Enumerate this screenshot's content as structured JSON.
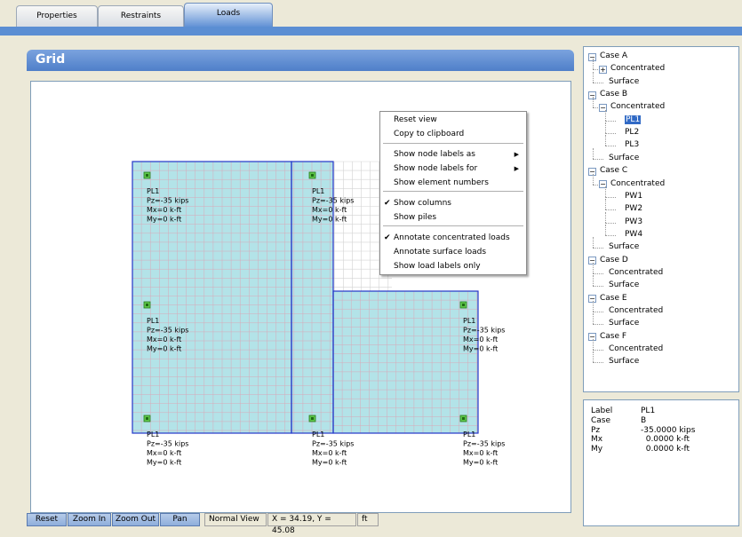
{
  "tabs": [
    {
      "label": "Properties",
      "active": false
    },
    {
      "label": "Restraints",
      "active": false
    },
    {
      "label": "Loads",
      "active": true
    }
  ],
  "panel": {
    "title": "Grid"
  },
  "status_bar": {
    "buttons": [
      "Reset",
      "Zoom In",
      "Zoom Out",
      "Pan"
    ],
    "view_mode": "Normal View",
    "coords": "X = 34.19, Y = 45.08",
    "units": "ft"
  },
  "context_menu": {
    "items": [
      {
        "label": "Reset view",
        "checked": false,
        "submenu": false
      },
      {
        "label": "Copy to clipboard",
        "checked": false,
        "submenu": false
      },
      {
        "label": "Show node labels as",
        "checked": false,
        "submenu": true
      },
      {
        "label": "Show node labels for",
        "checked": false,
        "submenu": true
      },
      {
        "label": "Show element numbers",
        "checked": false,
        "submenu": false
      },
      {
        "label": "Show columns",
        "checked": true,
        "submenu": false
      },
      {
        "label": "Show piles",
        "checked": false,
        "submenu": false
      },
      {
        "label": "Annotate concentrated loads",
        "checked": true,
        "submenu": false
      },
      {
        "label": "Annotate surface loads",
        "checked": false,
        "submenu": false
      },
      {
        "label": "Show load labels only",
        "checked": false,
        "submenu": false
      }
    ]
  },
  "tree": [
    {
      "label": "Case A",
      "depth": 0,
      "expander": "-"
    },
    {
      "label": "Concentrated",
      "depth": 1,
      "expander": "+"
    },
    {
      "label": "Surface",
      "depth": 1,
      "expander": ""
    },
    {
      "label": "Case B",
      "depth": 0,
      "expander": "-"
    },
    {
      "label": "Concentrated",
      "depth": 1,
      "expander": "-"
    },
    {
      "label": "PL1",
      "depth": 2,
      "expander": "",
      "selected": true
    },
    {
      "label": "PL2",
      "depth": 2,
      "expander": ""
    },
    {
      "label": "PL3",
      "depth": 2,
      "expander": ""
    },
    {
      "label": "Surface",
      "depth": 1,
      "expander": ""
    },
    {
      "label": "Case C",
      "depth": 0,
      "expander": "-"
    },
    {
      "label": "Concentrated",
      "depth": 1,
      "expander": "-"
    },
    {
      "label": "PW1",
      "depth": 2,
      "expander": ""
    },
    {
      "label": "PW2",
      "depth": 2,
      "expander": ""
    },
    {
      "label": "PW3",
      "depth": 2,
      "expander": ""
    },
    {
      "label": "PW4",
      "depth": 2,
      "expander": ""
    },
    {
      "label": "Surface",
      "depth": 1,
      "expander": ""
    },
    {
      "label": "Case D",
      "depth": 0,
      "expander": "-"
    },
    {
      "label": "Concentrated",
      "depth": 1,
      "expander": ""
    },
    {
      "label": "Surface",
      "depth": 1,
      "expander": ""
    },
    {
      "label": "Case E",
      "depth": 0,
      "expander": "-"
    },
    {
      "label": "Concentrated",
      "depth": 1,
      "expander": ""
    },
    {
      "label": "Surface",
      "depth": 1,
      "expander": ""
    },
    {
      "label": "Case F",
      "depth": 0,
      "expander": "-"
    },
    {
      "label": "Concentrated",
      "depth": 1,
      "expander": ""
    },
    {
      "label": "Surface",
      "depth": 1,
      "expander": ""
    }
  ],
  "properties": [
    {
      "key": "Label",
      "value": "PL1"
    },
    {
      "key": "Case",
      "value": "B"
    },
    {
      "key": "Pz",
      "value": "-35.0000 kips"
    },
    {
      "key": "Mx",
      "value": "  0.0000 k-ft"
    },
    {
      "key": "My",
      "value": "  0.0000 k-ft"
    }
  ],
  "grid": {
    "node_labels": [
      [
        "PL1",
        "Pz=-35 kips",
        "Mx=0 k-ft",
        "My=0 k-ft"
      ],
      [
        "PL1",
        "Pz=-35 kips",
        "Mx=0 k-ft",
        "My=0 k-ft"
      ],
      [
        "PL1",
        "Pz=-35 kips",
        "Mx=0 k-ft",
        "My=0 k-ft"
      ],
      [
        "PL1",
        "Pz=-35 kips",
        "Mx=0 k-ft",
        "My=0 k-ft"
      ],
      [
        "PL1",
        "Pz=-35 kips",
        "Mx=0 k-ft",
        "My=0 k-ft"
      ],
      [
        "PL1",
        "Pz=-35 kips",
        "Mx=0 k-ft",
        "My=0 k-ft"
      ],
      [
        "PL1",
        "Pz=-35 kips",
        "Mx=0 k-ft",
        "My=0 k-ft"
      ]
    ]
  },
  "colors": {
    "slab_fill": "#b3e3e8",
    "slab_border": "#2336c9",
    "grid_line": "#d8a9b8",
    "node_fill": "#5ec84a",
    "accent": "#5b8ed3"
  }
}
